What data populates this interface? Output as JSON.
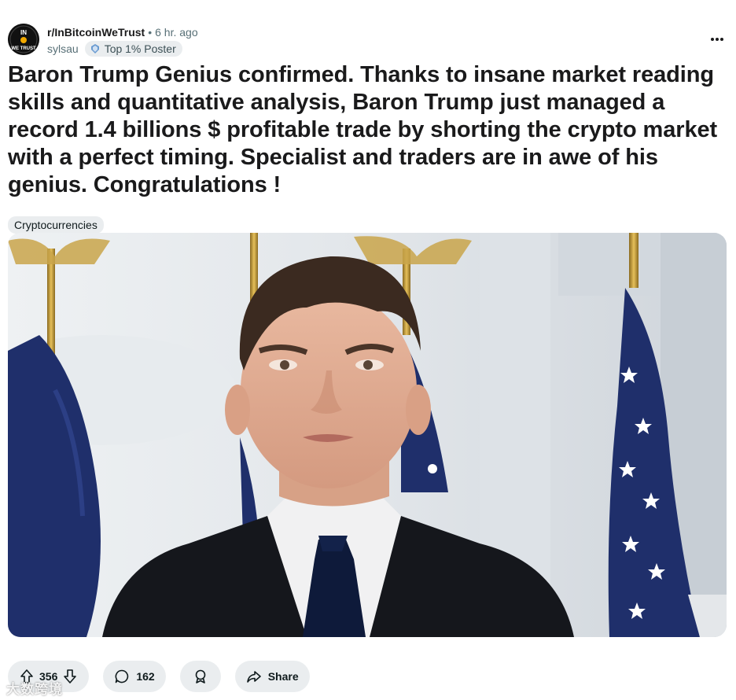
{
  "header": {
    "subreddit": "r/InBitcoinWeTrust",
    "separator": "•",
    "time": "6 hr. ago",
    "author": "sylsau",
    "flair": "Top 1% Poster",
    "avatar_text_top": "IN",
    "avatar_text_bottom": "WE TRUST"
  },
  "post": {
    "title": "Baron Trump Genius confirmed. Thanks to insane market reading skills and quantitative analysis, Baron Trump just managed a record 1.4 billions $ profitable trade by shorting the crypto market with a perfect timing. Specialist and traders are in awe of his genius. Congratulations !",
    "tag": "Cryptocurrencies"
  },
  "actions": {
    "upvotes": "356",
    "comments": "162",
    "share": "Share"
  },
  "watermark": "大数跨境",
  "colors": {
    "pill_bg": "#eaedef",
    "meta_text": "#576f76",
    "title_text": "#1a1a1b",
    "flag_blue": "#1f2f6b"
  },
  "icons": [
    "ellipsis-icon",
    "flair-badge-icon",
    "upvote-icon",
    "downvote-icon",
    "comment-icon",
    "award-icon",
    "share-icon"
  ]
}
